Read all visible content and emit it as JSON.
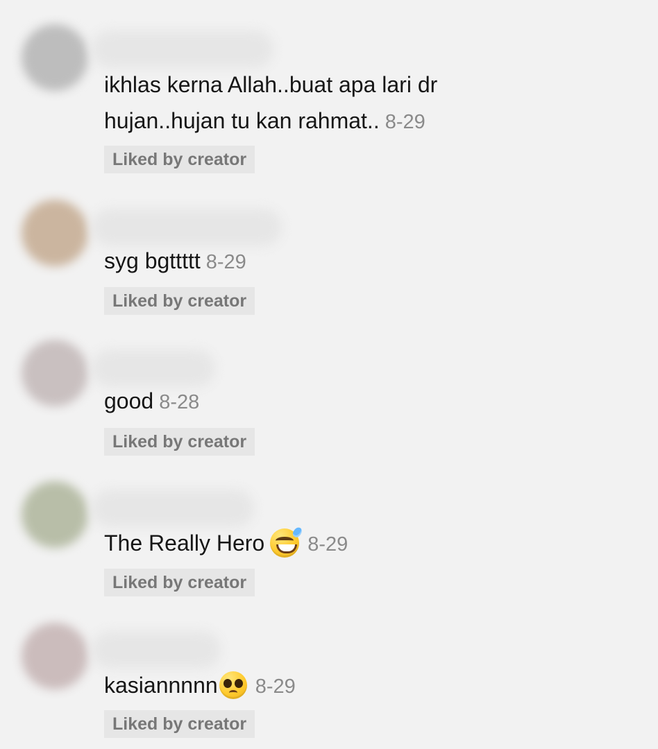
{
  "comments": [
    {
      "username": "",
      "text": "ikhlas kerna Allah..buat apa lari dr hujan..hujan tu kan rahmat..",
      "date": "8-29",
      "liked_label": "Liked by creator",
      "avatar_color": "#bdbdbd",
      "username_bar_color": "#e5e5e5"
    },
    {
      "username": "",
      "text": "syg bgttttt",
      "date": "8-29",
      "liked_label": "Liked by creator",
      "avatar_color": "#cbb59f",
      "username_bar_color": "#e5e5e5"
    },
    {
      "username": "",
      "text": "good",
      "date": "8-28",
      "liked_label": "Liked by creator",
      "avatar_color": "#c9c0c0",
      "username_bar_color": "#e5e5e5"
    },
    {
      "username": "",
      "text": "The Really Hero",
      "emoji": "grinning-face-with-sweat",
      "date": "8-29",
      "liked_label": "Liked by creator",
      "avatar_color": "#b8bea8",
      "username_bar_color": "#e5e5e5"
    },
    {
      "username": "",
      "text": "kasiannnnn",
      "emoji": "pleading-face",
      "date": "8-29",
      "liked_label": "Liked by creator",
      "avatar_color": "#cbbcbc",
      "username_bar_color": "#e5e5e5"
    }
  ],
  "colors": {
    "background": "#f2f2f2",
    "comment_text": "#161616",
    "date_text": "#8a8a8a",
    "liked_pill_bg": "#e6e6e6",
    "liked_pill_text": "#777777"
  }
}
